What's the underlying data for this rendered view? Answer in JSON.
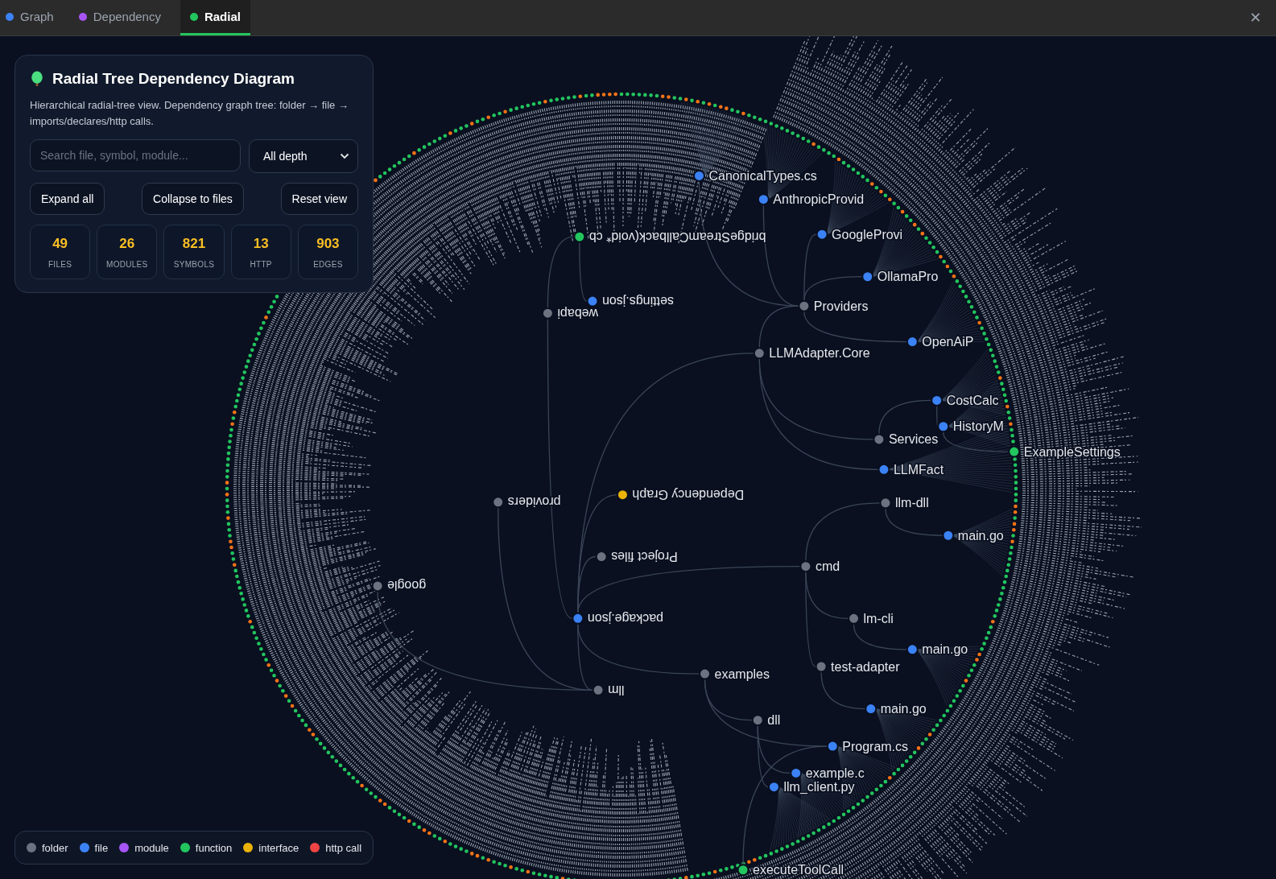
{
  "tabs": [
    {
      "label": "Graph",
      "selected": false,
      "color": "#3b82f6"
    },
    {
      "label": "Dependency",
      "selected": false,
      "color": "#a855f7"
    },
    {
      "label": "Radial",
      "selected": true,
      "color": "#22c55e"
    }
  ],
  "close_button": "✕",
  "panel": {
    "title": "Radial Tree Dependency Diagram",
    "description": "Hierarchical radial-tree view. Dependency graph tree: folder → file → imports/declares/http calls.",
    "search": {
      "placeholder": "Search file, symbol, module..."
    },
    "depth_select": {
      "value": "All depth"
    },
    "buttons": [
      "Expand all",
      "Collapse to files",
      "Reset view"
    ],
    "stats": [
      {
        "value": "49",
        "label": "FILES"
      },
      {
        "value": "26",
        "label": "MODULES"
      },
      {
        "value": "821",
        "label": "SYMBOLS"
      },
      {
        "value": "13",
        "label": "HTTP"
      },
      {
        "value": "903",
        "label": "EDGES"
      }
    ]
  },
  "tree": {
    "label": "package.json",
    "kind": "file",
    "children": [
      {
        "label": "webapi",
        "kind": "folder",
        "children": [
          {
            "label": "bridgeStreamCallback(void* cb",
            "kind": "function",
            "children": [
              {
                "label": "settings.json",
                "kind": "file"
              }
            ]
          }
        ]
      },
      {
        "label": "LLMAdapter.Core",
        "kind": "folder",
        "children": [
          {
            "label": "Providers",
            "kind": "folder",
            "children": [
              {
                "label": "CanonicalTypes.cs",
                "kind": "file"
              },
              {
                "label": "AnthropicProvid",
                "kind": "file"
              },
              {
                "label": "GoogleProvi",
                "kind": "file"
              },
              {
                "label": "OllamaPro",
                "kind": "file"
              },
              {
                "label": "OpenAiP",
                "kind": "file"
              }
            ]
          },
          {
            "label": "Services",
            "kind": "folder",
            "children": [
              {
                "label": "CostCalc",
                "kind": "file",
                "children": [
                  {
                    "label": "HistoryM",
                    "kind": "file",
                    "children": [
                      {
                        "label": "ExampleSettings",
                        "kind": "function"
                      }
                    ]
                  }
                ]
              }
            ]
          },
          {
            "label": "LLMFact",
            "kind": "file"
          }
        ]
      },
      {
        "label": "Dependency Graph",
        "kind": "interface"
      },
      {
        "label": "Project files",
        "kind": "folder"
      },
      {
        "label": "cmd",
        "kind": "folder",
        "children": [
          {
            "label": "llm-dll",
            "kind": "folder",
            "children": [
              {
                "label": "main.go",
                "kind": "file"
              }
            ]
          },
          {
            "label": "lm-cli",
            "kind": "folder",
            "children": [
              {
                "label": "main.go",
                "kind": "file"
              }
            ]
          },
          {
            "label": "test-adapter",
            "kind": "folder",
            "children": [
              {
                "label": "main.go",
                "kind": "file"
              }
            ]
          }
        ]
      },
      {
        "label": "examples",
        "kind": "folder",
        "children": [
          {
            "label": "dll",
            "kind": "folder",
            "children": [
              {
                "label": "example.c",
                "kind": "file"
              },
              {
                "label": "llm_client.py",
                "kind": "file"
              }
            ]
          },
          {
            "label": "Program.cs",
            "kind": "file",
            "children": [
              {
                "label": "executeToolCall",
                "kind": "function"
              }
            ]
          }
        ]
      },
      {
        "label": "llm",
        "kind": "folder",
        "children": [
          {
            "label": "providers",
            "kind": "folder"
          },
          {
            "label": "google",
            "kind": "folder"
          }
        ]
      }
    ]
  },
  "legend": [
    {
      "label": "folder",
      "color": "#6b7280"
    },
    {
      "label": "file",
      "color": "#3b82f6"
    },
    {
      "label": "module",
      "color": "#a855f7"
    },
    {
      "label": "function",
      "color": "#22c55e"
    },
    {
      "label": "interface",
      "color": "#eab308"
    },
    {
      "label": "http call",
      "color": "#ef4444"
    }
  ]
}
